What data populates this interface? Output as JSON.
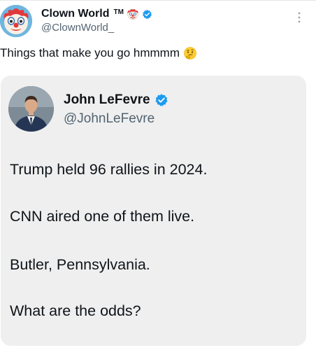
{
  "post": {
    "author": {
      "name": "Clown World",
      "trademark": "TM",
      "handle": "@ClownWorld_",
      "avatar_icon": "clown-face-icon",
      "name_emoji_icon": "clown-face-icon",
      "verified_icon": "verified-badge-icon"
    },
    "menu_icon": "more-vertical-icon",
    "text": "Things that make you go hmmmm",
    "text_emoji_icon": "thinking-face-icon"
  },
  "quoted_post": {
    "author": {
      "name": "John LeFevre",
      "handle": "@JohnLeFevre",
      "verified_icon": "verified-badge-icon"
    },
    "lines": [
      "Trump held 96 rallies in 2024.",
      "CNN aired one of them live.",
      "Butler, Pennsylvania.",
      "What are the odds?"
    ]
  },
  "colors": {
    "text_primary": "#0f1419",
    "text_secondary": "#536471",
    "verified_blue": "#1d9bf0",
    "quote_background": "#efefef"
  }
}
